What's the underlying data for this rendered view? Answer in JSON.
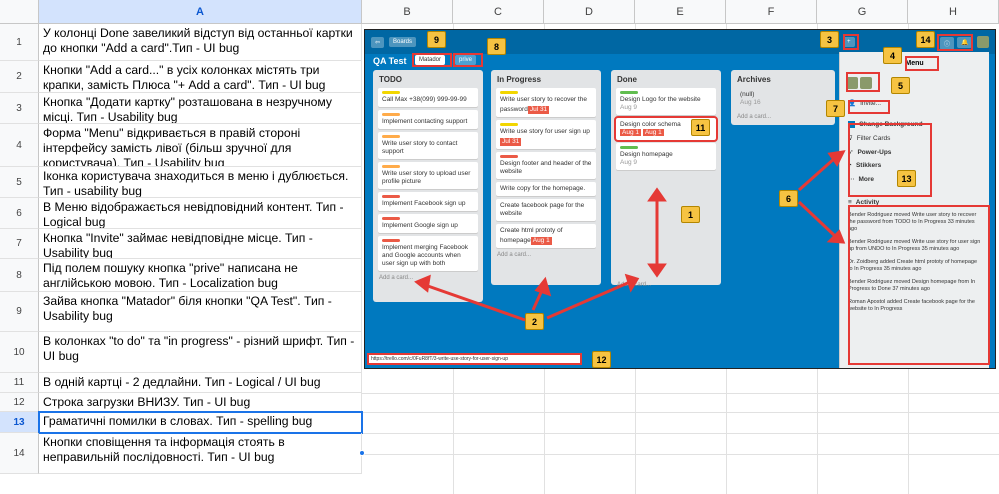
{
  "sheet": {
    "column_headers": [
      "A",
      "B",
      "C",
      "D",
      "E",
      "F",
      "G",
      "H"
    ],
    "rows": [
      {
        "n": "1",
        "text": "У колонці Done завеликий відступ від останньої картки до кнопки \"Add a card\".Тип - UI bug"
      },
      {
        "n": "2",
        "text": "Кнопки \"Add a card...\" в усіх колонках містять три крапки, замість Плюса \"+ Add a card\". Тип - UI bug"
      },
      {
        "n": "3",
        "text": "Кнопка \"Додати картку\" розташована в незручному місці. Тип - Usability bug"
      },
      {
        "n": "4",
        "text": "Форма \"Menu\" відкривається в правій стороні інтерфейсу замість лівої (більш зручної для користувача). Тип - Usability bug"
      },
      {
        "n": "5",
        "text": "Іконка користувача знаходиться в меню і дублюється. Тип - usability bug"
      },
      {
        "n": "6",
        "text": "В Меню відображається невідповідний контент. Тип - Logical bug"
      },
      {
        "n": "7",
        "text": "Кнопка \"Invite\" займає невідповідне місце. Тип - Usability bug"
      },
      {
        "n": "8",
        "text": "Під полем пошуку кнопка \"prive\" написана не англійською мовою. Тип - Localization bug"
      },
      {
        "n": "9",
        "text": "Зайва кнопка \"Matador\" біля кнопки \"QA Test\". Тип - Usability bug"
      },
      {
        "n": "10",
        "text": "В колонках \"to do\"  та \"in progress\" - різний шрифт. Тип - UI bug"
      },
      {
        "n": "11",
        "text": "В одній картці - 2 дедлайни. Тип - Logical / UI bug"
      },
      {
        "n": "12",
        "text": "Строка загрузки ВНИЗУ. Тип - UI bug"
      },
      {
        "n": "13",
        "text": "Граматичні помилки в словах. Тип - spelling bug"
      },
      {
        "n": "14",
        "text": "Кнопки сповіщення та інформація стоять в неправильній послідовності. Тип - UI bug"
      }
    ]
  },
  "screenshot": {
    "boards_label": "Boards",
    "board_name": "QA Test",
    "matador": "Matador",
    "prive": "prive",
    "lists": {
      "todo": {
        "title": "TODO",
        "cards": [
          "Call Max +38(099) 999-99-99",
          "Implement contacting support",
          "Write user story to contact support",
          "Write user story to upload user profile picture",
          "Implement Facebook sign up",
          "Implement Google sign up",
          "Implement merging Facebook and Google accounts when user sign up with both"
        ],
        "add": "Add a card..."
      },
      "inprogress": {
        "title": "In Progress",
        "cards": [
          "Write user story to recover the password",
          "Write use story for user sign up",
          "Design footer and header of the website",
          "Write copy for the homepage.",
          "Create facebook page for the website",
          "Create html prototy of homepage"
        ],
        "dates": [
          "Jul 31",
          "Jul 31",
          "Aug 1"
        ],
        "add": "Add a card..."
      },
      "done": {
        "title": "Done",
        "cards": [
          "Design Logo for the website",
          "Design color schema",
          "Design homepage"
        ],
        "dates": [
          "Aug 9",
          "Aug 1",
          "Aug 1",
          "Aug 9"
        ],
        "add": "Add a card..."
      },
      "archives": {
        "title": "Archives",
        "cards": [
          "(null)"
        ],
        "dates": [
          "Aug 16"
        ],
        "add": "Add a card..."
      }
    },
    "menu": {
      "title": "Menu",
      "invite": "Invite...",
      "items": [
        "Change Background",
        "Filter Cards",
        "Power-Ups",
        "Stikkers",
        "More"
      ],
      "activity_title": "Activity",
      "activity": [
        "Bender Rodriguez moved Write user story to recover the password from TODO to In Progress 33 minutes ago",
        "Bender Rodriguez moved Write use story for user sign up from UNDO to In Progress 35 minutes ago",
        "Dr. Zoidberg added Create html prototy of homepage to In Progress 35 minutes ago",
        "Bender Rodriguez moved Design homepage from In Progress to Done 37 minutes ago",
        "Roman Apostol added Create facebook page for the website to In Progress"
      ]
    },
    "url": "https://trello.com/c/0FuR8fT/3-write-use-story-for-user-sign-up",
    "badges": [
      "1",
      "2",
      "3",
      "4",
      "5",
      "6",
      "7",
      "8",
      "9",
      "11",
      "12",
      "13",
      "14"
    ]
  },
  "colors": {
    "board": "#0079bf",
    "badge": "#f6c342",
    "highlight": "#e53935",
    "selection": "#1a73e8"
  }
}
